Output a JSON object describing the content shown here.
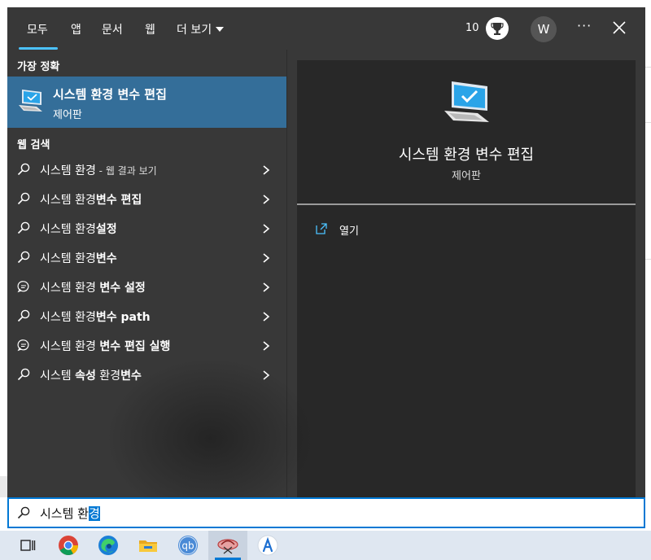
{
  "tabs": [
    {
      "label": "모두",
      "active": true
    },
    {
      "label": "앱"
    },
    {
      "label": "문서"
    },
    {
      "label": "웹"
    },
    {
      "label": "더 보기"
    }
  ],
  "header": {
    "points": "10",
    "avatar_initial": "W",
    "more_label": "···"
  },
  "best_match": {
    "section_label": "가장 정확",
    "title": "시스템 환경 변수 편집",
    "subtitle": "제어판",
    "icon": "monitor-settings-icon"
  },
  "web_search": {
    "section_label": "웹 검색",
    "results": [
      {
        "parts": [
          {
            "t": "시스템 환경",
            "b": false
          }
        ],
        "suffix": " - 웹 결과 보기",
        "icon": "search-icon"
      },
      {
        "parts": [
          {
            "t": "시스템 환경",
            "b": false
          },
          {
            "t": "변수 편집",
            "b": true
          }
        ],
        "suffix": "",
        "icon": "search-icon"
      },
      {
        "parts": [
          {
            "t": "시스템 환경",
            "b": false
          },
          {
            "t": "설정",
            "b": true
          }
        ],
        "suffix": "",
        "icon": "search-icon"
      },
      {
        "parts": [
          {
            "t": "시스템 환경",
            "b": false
          },
          {
            "t": "변수",
            "b": true
          }
        ],
        "suffix": "",
        "icon": "search-icon"
      },
      {
        "parts": [
          {
            "t": "시스템 환경 ",
            "b": false
          },
          {
            "t": "변수 설정",
            "b": true
          }
        ],
        "suffix": "",
        "icon": "chat-bubble-icon"
      },
      {
        "parts": [
          {
            "t": "시스템 환경",
            "b": false
          },
          {
            "t": "변수 path",
            "b": true
          }
        ],
        "suffix": "",
        "icon": "search-icon"
      },
      {
        "parts": [
          {
            "t": "시스템 환경 ",
            "b": false
          },
          {
            "t": "변수 편집 실행",
            "b": true
          }
        ],
        "suffix": "",
        "icon": "chat-bubble-icon"
      },
      {
        "parts": [
          {
            "t": "시스템 ",
            "b": false
          },
          {
            "t": "속성",
            "b": true
          },
          {
            "t": " 환경",
            "b": false
          },
          {
            "t": "변수",
            "b": true
          }
        ],
        "suffix": "",
        "icon": "search-icon"
      }
    ]
  },
  "preview": {
    "title": "시스템 환경 변수 편집",
    "subtitle": "제어판",
    "action_label": "열기"
  },
  "search": {
    "query_prefix": "시스템 환",
    "query_selected": "경"
  },
  "taskbar": {
    "items": [
      "task-view-icon",
      "chrome-icon",
      "edge-icon",
      "file-explorer-icon",
      "qbittorrent-icon",
      "snipping-app-icon",
      "appstore-icon"
    ],
    "qb_label": "qb"
  },
  "colors": {
    "accent": "#4cc2ff",
    "highlight": "#346e99",
    "selection": "#0078d4",
    "panel": "#383838"
  }
}
